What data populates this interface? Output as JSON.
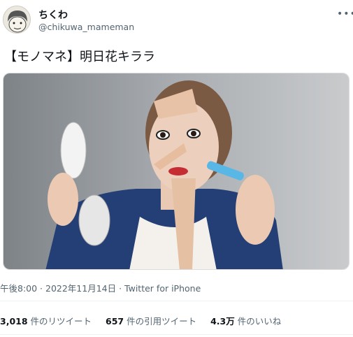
{
  "user": {
    "display_name": "ちくわ",
    "handle": "@chikuwa_mameman",
    "avatar_icon": "cartoon-face-avatar-icon"
  },
  "more_icon": "ellipsis-icon",
  "tweet": {
    "text": "【モノマネ】明日花キララ"
  },
  "meta": {
    "time": "午後8:00",
    "sep1": " · ",
    "date": "2022年11月14日",
    "sep2": " · ",
    "source": "Twitter for iPhone"
  },
  "stats": {
    "retweets_count": "3,018",
    "retweets_label": " 件のリツイート",
    "quotes_count": "657",
    "quotes_label": " 件の引用ツイート",
    "likes_count": "4.3万",
    "likes_label": " 件のいいね"
  },
  "colors": {
    "text_primary": "#0f1419",
    "text_secondary": "#536471",
    "divider": "#eff3f4"
  }
}
